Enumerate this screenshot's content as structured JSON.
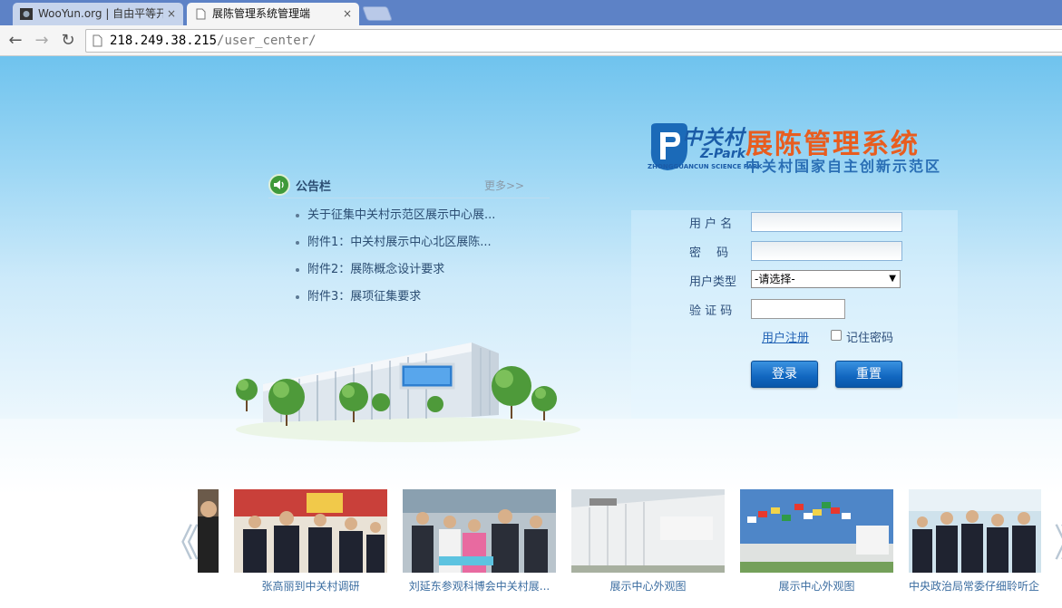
{
  "browser": {
    "tabs": [
      {
        "title": "WooYun.org | 自由平等开",
        "active": false
      },
      {
        "title": "展陈管理系统管理端",
        "active": true
      }
    ],
    "close_glyph": "×",
    "address": {
      "host": "218.249.38.215",
      "path": "/user_center/"
    },
    "nav": {
      "back": "←",
      "forward": "→",
      "reload": "↻"
    }
  },
  "logo": {
    "brand_cn": "中关村",
    "brand_en": "Z-Park",
    "brand_full_en": "ZHONGGUANCUN SCIENCE PARK",
    "title": "展陈管理系统",
    "subtitle": "中关村国家自主创新示范区"
  },
  "notice": {
    "title": "公告栏",
    "more": "更多>>",
    "items": [
      "关于征集中关村示范区展示中心展...",
      "附件1：中关村展示中心北区展陈...",
      "附件2：展陈概念设计要求",
      "附件3：展项征集要求"
    ]
  },
  "login": {
    "username_label": "用 户 名",
    "password_label": "密　 码",
    "usertype_label": "用户类型",
    "usertype_selected": "-请选择-",
    "captcha_label": "验 证 码",
    "register_link": "用户注册",
    "remember_label": "记住密码",
    "login_button": "登录",
    "reset_button": "重置"
  },
  "gallery": {
    "prev": "《",
    "next": "》",
    "captions": [
      "张高丽到中关村调研",
      "刘延东参观科博会中关村展...",
      "展示中心外观图",
      "展示中心外观图",
      "中央政治局常委仔细聆听企"
    ]
  },
  "colors": {
    "tab_strip": "#5d82c6",
    "sky_top": "#6fc3ee",
    "brand_blue": "#1b5ca8",
    "title_orange": "#e85d1f",
    "button_blue": "#1166c0"
  }
}
